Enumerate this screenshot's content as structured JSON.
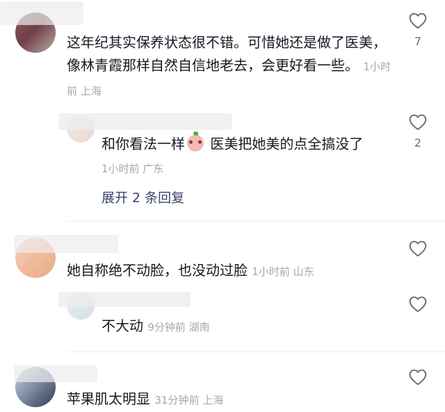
{
  "comments": [
    {
      "text": "这年纪其实保养状态很不错。可惜她还是做了医美，像林青霞那样自然自信地老去，会更好看一些。",
      "meta": "1小时前 上海",
      "likes": "7",
      "replies": [
        {
          "text_before": "和你看法一样",
          "emoji_icon": "peach-face-emoji",
          "text_after": " 医美把她美的点全搞没了",
          "meta": "1小时前 广东",
          "likes": "2"
        }
      ],
      "expand_label": "展开 2 条回复"
    },
    {
      "text": "她自称绝不动脸，也没动过脸",
      "meta": "1小时前 山东",
      "replies": [
        {
          "text": "不大动",
          "meta": "9分钟前 湖南"
        }
      ]
    },
    {
      "text": "苹果肌太明显",
      "meta": "31分钟前 上海"
    }
  ],
  "colors": {
    "text": "#161823",
    "meta": "#a5a7ad",
    "expand": "#39436b",
    "icon": "#6b6d73"
  },
  "icons": {
    "like": "heart-outline-icon"
  }
}
